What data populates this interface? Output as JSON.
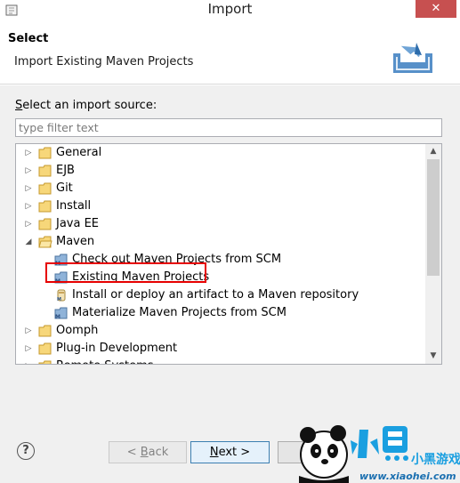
{
  "window": {
    "title": "Import",
    "close_symbol": "✕"
  },
  "header": {
    "title": "Select",
    "description": "Import Existing Maven Projects"
  },
  "source": {
    "label_prefix": "S",
    "label_rest": "elect an import source:",
    "filter_placeholder": "type filter text"
  },
  "tree": {
    "items": [
      {
        "label": "General",
        "icon": "folder-icon",
        "expanded": false
      },
      {
        "label": "EJB",
        "icon": "folder-icon",
        "expanded": false
      },
      {
        "label": "Git",
        "icon": "folder-icon",
        "expanded": false
      },
      {
        "label": "Install",
        "icon": "folder-icon",
        "expanded": false
      },
      {
        "label": "Java EE",
        "icon": "folder-icon",
        "expanded": false
      },
      {
        "label": "Maven",
        "icon": "folder-open-icon",
        "expanded": true
      },
      {
        "label": "Check out Maven Projects from SCM",
        "icon": "maven-project-icon"
      },
      {
        "label": "Existing Maven Projects",
        "icon": "maven-project-icon",
        "selected": true
      },
      {
        "label": "Install or deploy an artifact to a Maven repository",
        "icon": "maven-jar-icon"
      },
      {
        "label": "Materialize Maven Projects from SCM",
        "icon": "maven-project-icon"
      },
      {
        "label": "Oomph",
        "icon": "folder-icon",
        "expanded": false
      },
      {
        "label": "Plug-in Development",
        "icon": "folder-icon",
        "expanded": false
      },
      {
        "label": "Remote Systems",
        "icon": "folder-icon",
        "expanded": false
      }
    ]
  },
  "buttons": {
    "help": "?",
    "back_prefix": "< ",
    "back_key": "B",
    "back_rest": "ack",
    "next_key": "N",
    "next_rest": "ext >"
  },
  "watermark": {
    "text": "小黑游戏",
    "url": "www.xiaohei.com"
  },
  "colors": {
    "highlight_border": "#e60000",
    "close_button": "#c75050",
    "primary_button_border": "#3c7fb1"
  }
}
